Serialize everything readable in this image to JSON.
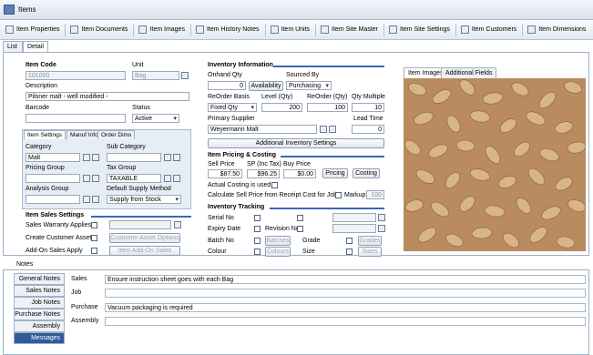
{
  "window": {
    "title": "Items"
  },
  "toolbar": [
    "Item Properties",
    "Item Documents",
    "Item Images",
    "Item History Notes",
    "Item Units",
    "Item Site Master",
    "Item Site Settings",
    "Item Customers",
    "Item Dimensions"
  ],
  "tabs": {
    "list": "List",
    "detail": "Detail"
  },
  "item": {
    "code_label": "Item Code",
    "code": "101000",
    "unit_label": "Unit",
    "unit": "Bag",
    "desc_label": "Description",
    "desc": "Pilsner malt - well modified -",
    "barcode_label": "Barcode",
    "barcode": "",
    "status_label": "Status",
    "status": "Active"
  },
  "subtabs": [
    "Item Settings",
    "Manuf Info",
    "Order Dims"
  ],
  "settings": {
    "category_label": "Category",
    "category": "Malt",
    "subcat_label": "Sub Category",
    "subcat": "",
    "pricing_label": "Pricing Group",
    "pricing": "",
    "tax_label": "Tax Group",
    "tax": "TAXABLE",
    "analysis_label": "Analysis Group",
    "analysis": "",
    "supply_label": "Default Supply Method",
    "supply": "Supply from Stock"
  },
  "sales": {
    "title": "Item Sales Settings",
    "warranty": "Sales Warranty Applies",
    "customer_asset": "Create Customer Asset",
    "addon": "Add-On Sales Apply",
    "ca_btn": "Customer Asset Options",
    "addon_btn": "Item Add-On Sales"
  },
  "inv": {
    "title": "Inventory Information",
    "onhand_label": "Onhand Qty",
    "onhand": "0",
    "avail_btn": "Availability",
    "sourced_label": "Sourced By",
    "sourced": "Purchasing",
    "reorder_basis_label": "ReOrder Basis",
    "reorder_basis": "Fixed Qty",
    "level_label": "Level (Qty)",
    "level": "200",
    "reorder_qty_label": "ReOrder (Qty)",
    "reorder_qty": "100",
    "multiple_label": "Qty Multiple",
    "multiple": "10",
    "supplier_label": "Primary Supplier",
    "supplier": "Weyermann Malt",
    "lead_label": "Lead Time",
    "lead": "0",
    "addl_btn": "Additional Inventory Settings"
  },
  "pricing": {
    "title": "Item Pricing & Costing",
    "sell_label": "Sell Price",
    "sell": "$87.50",
    "sp_label": "SP (Inc Tax)",
    "sp": "$96.25",
    "buy_label": "Buy Price",
    "buy": "$0.00",
    "pricing_btn": "Pricing",
    "costing_btn": "Costing",
    "actual": "Actual Costing is used",
    "calc": "Calculate Sell Price from Receipt Cost for Jobs",
    "markup_label": "Markup",
    "markup": "100"
  },
  "tracking": {
    "title": "Inventory Tracking",
    "serial": "Serial No",
    "expiry": "Expiry Date",
    "revision": "Revision No",
    "batch": "Batch No",
    "batches_btn": "Batches",
    "grade": "Grade",
    "grades_btn": "Grades",
    "colour": "Colour",
    "colours_btn": "Colours",
    "size": "Size",
    "sizes_btn": "Sizes"
  },
  "image_tabs": [
    "Item Images",
    "Additional Fields"
  ],
  "notes": {
    "label": "Notes",
    "tabs": [
      "General Notes",
      "Sales Notes",
      "Job Notes",
      "Purchase Notes",
      "Assembly Notes",
      "Messages"
    ],
    "rows": [
      {
        "label": "Sales",
        "value": "Ensure instruction sheet goes with each Bag"
      },
      {
        "label": "Job",
        "value": ""
      },
      {
        "label": "Purchase",
        "value": "Vacuum packaging is required"
      },
      {
        "label": "Assembly",
        "value": ""
      }
    ]
  },
  "colors": {
    "accent": "#3a67b8",
    "active_tab": "#2f5b9a"
  }
}
